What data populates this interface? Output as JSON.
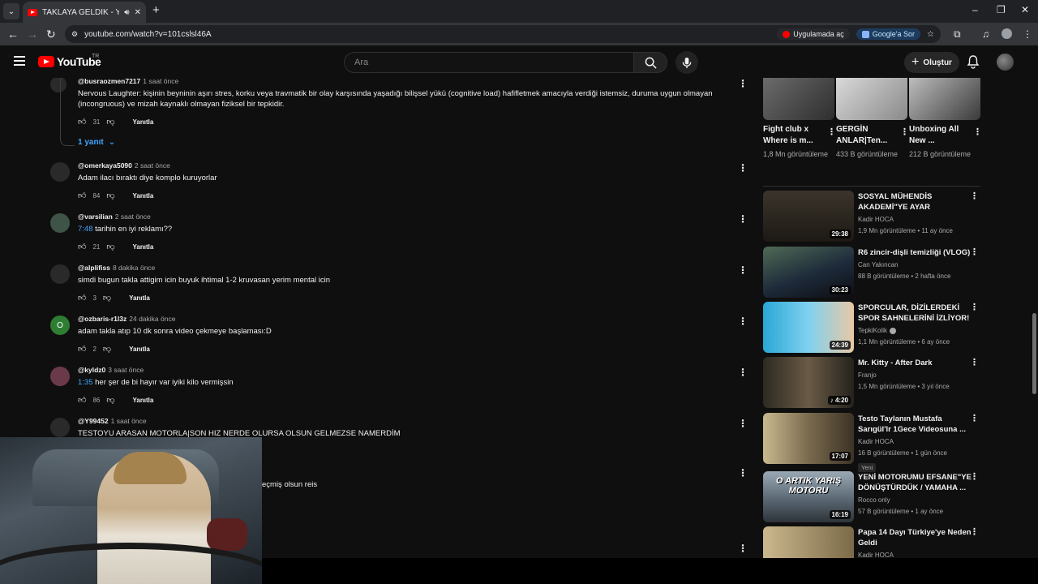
{
  "browser": {
    "tab_title": "TAKLAYA GELDİK - YouTube",
    "url": "youtube.com/watch?v=101cslsl46A",
    "open_app": "Uygulamada aç",
    "google_ask": "Google'a Sor"
  },
  "header": {
    "logo": "YouTube",
    "country": "TR",
    "search_placeholder": "Ara",
    "create": "Oluştur"
  },
  "comments": {
    "reply_label": "Yanıtla",
    "replies_toggle": "1 yanıt",
    "items": [
      {
        "author": "@busraozmen7217",
        "time": "1 saat önce",
        "text": "Nervous Laughter: kişinin beyninin aşırı stres, korku veya travmatik bir olay karşısında yaşadığı bilişsel yükü (cognitive load) hafifletmek amacıyla verdiği istemsiz, duruma uygun olmayan (incongruous) ve mizah kaynaklı olmayan fiziksel bir tepkidir.",
        "likes": "31"
      },
      {
        "author": "@omerkaya5090",
        "time": "2 saat önce",
        "text": "Adam ilacı bıraktı diye komplo kuruyorlar",
        "likes": "84"
      },
      {
        "author": "@varsilian",
        "time": "2 saat önce",
        "timestamp": "7:48",
        "text": "tarihin en iyi reklamı??",
        "likes": "21"
      },
      {
        "author": "@alplifiss",
        "time": "8 dakika önce",
        "text": "simdi bugun takla attigim icin buyuk ihtimal 1-2 kruvasan yerim mental icin",
        "likes": "3"
      },
      {
        "author": "@ozbaris-r1l3z",
        "time": "24 dakika önce",
        "text": "adam takla atıp 10 dk sonra video çekmeye başlaması:D",
        "likes": "2",
        "avatar_letter": "O"
      },
      {
        "author": "@kyldz0",
        "time": "3 saat önce",
        "timestamp": "1:35",
        "text": "her şer de bi hayır var iyiki kilo vermişsin",
        "likes": "86"
      },
      {
        "author": "@Y99452",
        "time": "1 saat önce",
        "text": "TESTOYU ARASAN MOTORLA|SON HIZ NERDE OLURSA OLSUN GELMEZSE NAMERDİM"
      },
      {
        "text": "eçmiş olsun reis"
      }
    ]
  },
  "shorts": [
    {
      "title": "Fight club x Where is m...",
      "views": "1,8 Mn görüntüleme"
    },
    {
      "title": "GERGİN ANLAR|Ten...",
      "views": "433 B görüntüleme"
    },
    {
      "title": "Unboxing All New ...",
      "views": "212 B görüntüleme"
    }
  ],
  "videos": [
    {
      "title": "SOSYAL MÜHENDİS AKADEMİ\"YE AYAR",
      "channel": "Kadir HOCA",
      "meta": "1,9 Mn görüntüleme • 11 ay önce",
      "duration": "29:38"
    },
    {
      "title": "R6 zincir-dişli temizliği (VLOG)",
      "channel": "Can Yakıncan",
      "meta": "88 B görüntüleme • 2 hafta önce",
      "duration": "30:23"
    },
    {
      "title": "SPORCULAR, DİZİLERDEKİ SPOR SAHNELERİNİ İZLİYOR!",
      "channel": "TepkiKolik",
      "meta": "1,1 Mn görüntüleme • 6 ay önce",
      "duration": "24:39"
    },
    {
      "title": "Mr. Kitty - After Dark",
      "channel": "Franjo",
      "meta": "1,5 Mn görüntüleme • 3 yıl önce",
      "duration": "4:20"
    },
    {
      "title": "Testo Taylanın Mustafa Sarıgül'lr 1Gece Videosuna ...",
      "channel": "Kadir HOCA",
      "meta": "16 B görüntüleme • 1 gün önce",
      "duration": "17:07",
      "badge": "Yeni"
    },
    {
      "title": "YENİ MOTORUMU EFSANE\"YE DÖNÜŞTÜRDÜK / YAMAHA ...",
      "channel": "Rocco only",
      "meta": "57 B görüntüleme • 1 ay önce",
      "duration": "16:19",
      "thumb_text": "O ARTIK YARIŞ MOTORU"
    },
    {
      "title": "Papa 14 Dayı Türkiye'ye Neden Geldi",
      "channel": "Kadir HOCA"
    }
  ]
}
